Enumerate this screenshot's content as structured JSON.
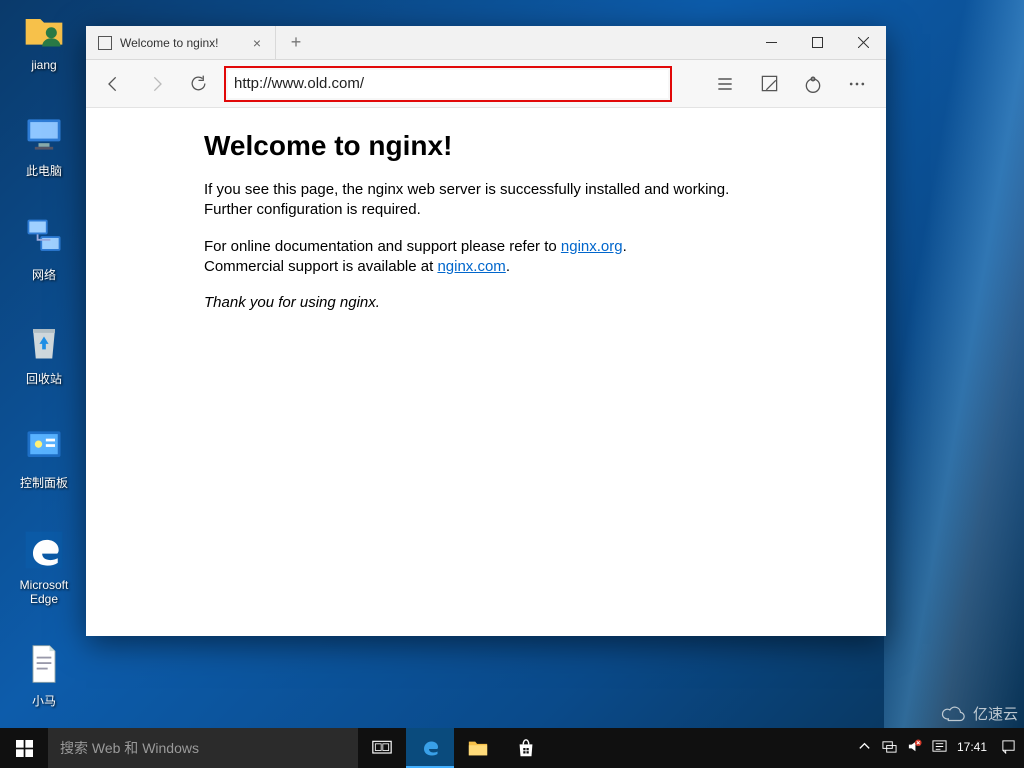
{
  "desktop_icons": {
    "user": "jiang",
    "computer": "此电脑",
    "network": "网络",
    "recycle": "回收站",
    "control_panel": "控制面板",
    "edge_top": "Microsoft",
    "edge_bot": "Edge",
    "txt": "小马"
  },
  "browser": {
    "tab_title": "Welcome to nginx!",
    "url": "http://www.old.com/"
  },
  "page": {
    "h1": "Welcome to nginx!",
    "p1": "If you see this page, the nginx web server is successfully installed and working. Further configuration is required.",
    "p2a": "For online documentation and support please refer to ",
    "link1": "nginx.org",
    "p2b": ".",
    "p3a": "Commercial support is available at ",
    "link2": "nginx.com",
    "p3b": ".",
    "thanks": "Thank you for using nginx."
  },
  "taskbar": {
    "search_placeholder": "搜索 Web 和 Windows",
    "clock_time": "17:41"
  },
  "watermark": "亿速云"
}
